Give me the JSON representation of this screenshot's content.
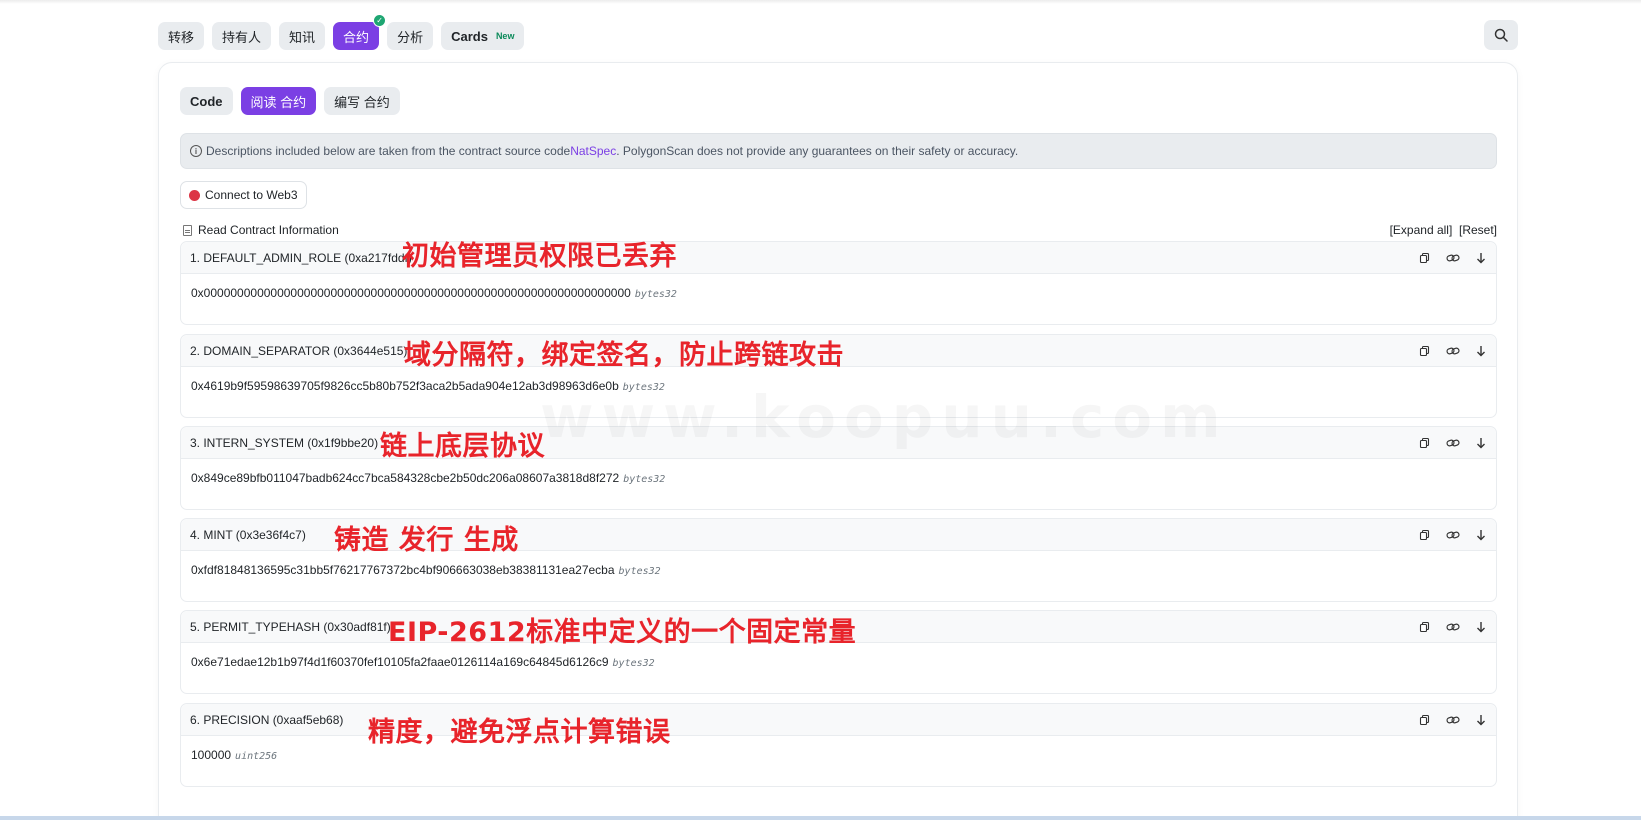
{
  "nav_tabs": [
    {
      "label": "转移"
    },
    {
      "label": "持有人"
    },
    {
      "label": "知讯"
    },
    {
      "label": "合约"
    },
    {
      "label": "分析"
    },
    {
      "label": "Cards",
      "badge": "New"
    }
  ],
  "sub_tabs": [
    {
      "label": "Code"
    },
    {
      "label": "阅读 合约"
    },
    {
      "label": "编写 合约"
    }
  ],
  "notice": {
    "text_before": "Descriptions included below are taken from the contract source code ",
    "link": "NatSpec",
    "text_after": ". PolygonScan does not provide any guarantees on their safety or accuracy."
  },
  "connect_button": "Connect to Web3",
  "read_info_label": "Read Contract Information",
  "expand_all": "[Expand all]",
  "reset": "[Reset]",
  "items": [
    {
      "title": "1. DEFAULT_ADMIN_ROLE (0xa217fddf)",
      "value": "0x0000000000000000000000000000000000000000000000000000000000000000",
      "type": "bytes32",
      "annotation": "初始管理员权限已丢弃"
    },
    {
      "title": "2. DOMAIN_SEPARATOR (0x3644e515)",
      "value": "0x4619b9f59598639705f9826cc5b80b752f3aca2b5ada904e12ab3d98963d6e0b",
      "type": "bytes32",
      "annotation": "域分隔符，绑定签名，防止跨链攻击"
    },
    {
      "title": "3. INTERN_SYSTEM (0x1f9bbe20)",
      "value": "0x849ce89bfb011047badb624cc7bca584328cbe2b50dc206a08607a3818d8f272",
      "type": "bytes32",
      "annotation": "链上底层协议"
    },
    {
      "title": "4. MINT (0x3e36f4c7)",
      "value": "0xfdf81848136595c31bb5f76217767372bc4bf906663038eb38381131ea27ecba",
      "type": "bytes32",
      "annotation": "铸造 发行 生成"
    },
    {
      "title": "5. PERMIT_TYPEHASH (0x30adf81f)",
      "value": "0x6e71edae12b1b97f4d1f60370fef10105fa2faae0126114a169c64845d6126c9",
      "type": "bytes32",
      "annotation": "EIP-2612标准中定义的一个固定常量"
    },
    {
      "title": "6. PRECISION (0xaaf5eb68)",
      "value": "100000",
      "type": "uint256",
      "annotation": "精度，避免浮点计算错误"
    }
  ],
  "watermark": "www.koopuu.com",
  "colors": {
    "accent": "#7b3fe4",
    "annotation": "#e8242b",
    "connect_dot": "#dc3545",
    "check": "#1ea672"
  }
}
